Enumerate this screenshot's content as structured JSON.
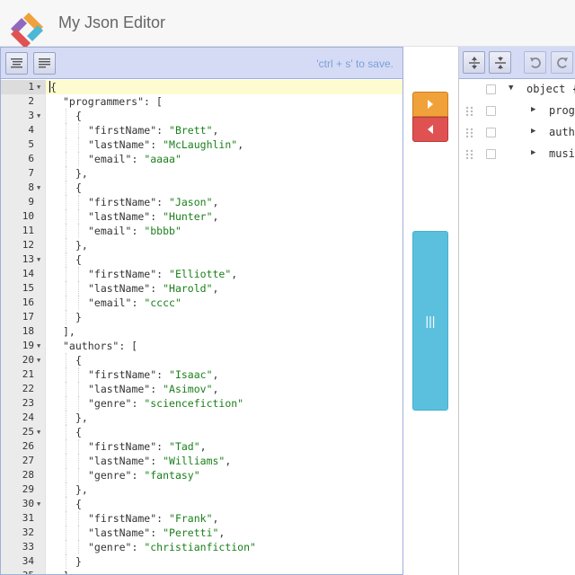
{
  "app": {
    "title": "My Json Editor"
  },
  "left_toolbar": {
    "format_label": "Format",
    "compact_label": "Compact",
    "save_hint": "'ctrl + s' to save."
  },
  "code_lines": [
    {
      "n": "1",
      "fold": true,
      "indent": 0,
      "parts": [
        [
          "p",
          "{"
        ]
      ],
      "active": true
    },
    {
      "n": "2",
      "fold": false,
      "indent": 1,
      "parts": [
        [
          "k",
          "\"programmers\""
        ],
        [
          "p",
          ": ["
        ]
      ]
    },
    {
      "n": "3",
      "fold": true,
      "indent": 2,
      "parts": [
        [
          "p",
          "{"
        ]
      ]
    },
    {
      "n": "4",
      "fold": false,
      "indent": 3,
      "parts": [
        [
          "k",
          "\"firstName\""
        ],
        [
          "p",
          ": "
        ],
        [
          "s",
          "\"Brett\""
        ],
        [
          "p",
          ","
        ]
      ]
    },
    {
      "n": "5",
      "fold": false,
      "indent": 3,
      "parts": [
        [
          "k",
          "\"lastName\""
        ],
        [
          "p",
          ": "
        ],
        [
          "s",
          "\"McLaughlin\""
        ],
        [
          "p",
          ","
        ]
      ]
    },
    {
      "n": "6",
      "fold": false,
      "indent": 3,
      "parts": [
        [
          "k",
          "\"email\""
        ],
        [
          "p",
          ": "
        ],
        [
          "s",
          "\"aaaa\""
        ]
      ]
    },
    {
      "n": "7",
      "fold": false,
      "indent": 2,
      "parts": [
        [
          "p",
          "},"
        ]
      ]
    },
    {
      "n": "8",
      "fold": true,
      "indent": 2,
      "parts": [
        [
          "p",
          "{"
        ]
      ]
    },
    {
      "n": "9",
      "fold": false,
      "indent": 3,
      "parts": [
        [
          "k",
          "\"firstName\""
        ],
        [
          "p",
          ": "
        ],
        [
          "s",
          "\"Jason\""
        ],
        [
          "p",
          ","
        ]
      ]
    },
    {
      "n": "10",
      "fold": false,
      "indent": 3,
      "parts": [
        [
          "k",
          "\"lastName\""
        ],
        [
          "p",
          ": "
        ],
        [
          "s",
          "\"Hunter\""
        ],
        [
          "p",
          ","
        ]
      ]
    },
    {
      "n": "11",
      "fold": false,
      "indent": 3,
      "parts": [
        [
          "k",
          "\"email\""
        ],
        [
          "p",
          ": "
        ],
        [
          "s",
          "\"bbbb\""
        ]
      ]
    },
    {
      "n": "12",
      "fold": false,
      "indent": 2,
      "parts": [
        [
          "p",
          "},"
        ]
      ]
    },
    {
      "n": "13",
      "fold": true,
      "indent": 2,
      "parts": [
        [
          "p",
          "{"
        ]
      ]
    },
    {
      "n": "14",
      "fold": false,
      "indent": 3,
      "parts": [
        [
          "k",
          "\"firstName\""
        ],
        [
          "p",
          ": "
        ],
        [
          "s",
          "\"Elliotte\""
        ],
        [
          "p",
          ","
        ]
      ]
    },
    {
      "n": "15",
      "fold": false,
      "indent": 3,
      "parts": [
        [
          "k",
          "\"lastName\""
        ],
        [
          "p",
          ": "
        ],
        [
          "s",
          "\"Harold\""
        ],
        [
          "p",
          ","
        ]
      ]
    },
    {
      "n": "16",
      "fold": false,
      "indent": 3,
      "parts": [
        [
          "k",
          "\"email\""
        ],
        [
          "p",
          ": "
        ],
        [
          "s",
          "\"cccc\""
        ]
      ]
    },
    {
      "n": "17",
      "fold": false,
      "indent": 2,
      "parts": [
        [
          "p",
          "}"
        ]
      ]
    },
    {
      "n": "18",
      "fold": false,
      "indent": 1,
      "parts": [
        [
          "p",
          "],"
        ]
      ]
    },
    {
      "n": "19",
      "fold": true,
      "indent": 1,
      "parts": [
        [
          "k",
          "\"authors\""
        ],
        [
          "p",
          ": ["
        ]
      ]
    },
    {
      "n": "20",
      "fold": true,
      "indent": 2,
      "parts": [
        [
          "p",
          "{"
        ]
      ]
    },
    {
      "n": "21",
      "fold": false,
      "indent": 3,
      "parts": [
        [
          "k",
          "\"firstName\""
        ],
        [
          "p",
          ": "
        ],
        [
          "s",
          "\"Isaac\""
        ],
        [
          "p",
          ","
        ]
      ]
    },
    {
      "n": "22",
      "fold": false,
      "indent": 3,
      "parts": [
        [
          "k",
          "\"lastName\""
        ],
        [
          "p",
          ": "
        ],
        [
          "s",
          "\"Asimov\""
        ],
        [
          "p",
          ","
        ]
      ]
    },
    {
      "n": "23",
      "fold": false,
      "indent": 3,
      "parts": [
        [
          "k",
          "\"genre\""
        ],
        [
          "p",
          ": "
        ],
        [
          "s",
          "\"sciencefiction\""
        ]
      ]
    },
    {
      "n": "24",
      "fold": false,
      "indent": 2,
      "parts": [
        [
          "p",
          "},"
        ]
      ]
    },
    {
      "n": "25",
      "fold": true,
      "indent": 2,
      "parts": [
        [
          "p",
          "{"
        ]
      ]
    },
    {
      "n": "26",
      "fold": false,
      "indent": 3,
      "parts": [
        [
          "k",
          "\"firstName\""
        ],
        [
          "p",
          ": "
        ],
        [
          "s",
          "\"Tad\""
        ],
        [
          "p",
          ","
        ]
      ]
    },
    {
      "n": "27",
      "fold": false,
      "indent": 3,
      "parts": [
        [
          "k",
          "\"lastName\""
        ],
        [
          "p",
          ": "
        ],
        [
          "s",
          "\"Williams\""
        ],
        [
          "p",
          ","
        ]
      ]
    },
    {
      "n": "28",
      "fold": false,
      "indent": 3,
      "parts": [
        [
          "k",
          "\"genre\""
        ],
        [
          "p",
          ": "
        ],
        [
          "s",
          "\"fantasy\""
        ]
      ]
    },
    {
      "n": "29",
      "fold": false,
      "indent": 2,
      "parts": [
        [
          "p",
          "},"
        ]
      ]
    },
    {
      "n": "30",
      "fold": true,
      "indent": 2,
      "parts": [
        [
          "p",
          "{"
        ]
      ]
    },
    {
      "n": "31",
      "fold": false,
      "indent": 3,
      "parts": [
        [
          "k",
          "\"firstName\""
        ],
        [
          "p",
          ": "
        ],
        [
          "s",
          "\"Frank\""
        ],
        [
          "p",
          ","
        ]
      ]
    },
    {
      "n": "32",
      "fold": false,
      "indent": 3,
      "parts": [
        [
          "k",
          "\"lastName\""
        ],
        [
          "p",
          ": "
        ],
        [
          "s",
          "\"Peretti\""
        ],
        [
          "p",
          ","
        ]
      ]
    },
    {
      "n": "33",
      "fold": false,
      "indent": 3,
      "parts": [
        [
          "k",
          "\"genre\""
        ],
        [
          "p",
          ": "
        ],
        [
          "s",
          "\"christianfiction\""
        ]
      ]
    },
    {
      "n": "34",
      "fold": false,
      "indent": 2,
      "parts": [
        [
          "p",
          "}"
        ]
      ]
    },
    {
      "n": "35",
      "fold": false,
      "indent": 1,
      "parts": [
        [
          "p",
          "],"
        ]
      ]
    }
  ],
  "middle": {
    "splitter_label": "|||"
  },
  "tree": {
    "root": {
      "label": "object",
      "suffix": "{"
    },
    "children": [
      {
        "label": "prog"
      },
      {
        "label": "auth"
      },
      {
        "label": "musi"
      }
    ]
  },
  "colors": {
    "toolbar_bg": "#d5dbf5",
    "copy_right": "#f0a13a",
    "copy_left": "#e05252",
    "splitter": "#5bc0de",
    "string": "#1a7f1a"
  }
}
